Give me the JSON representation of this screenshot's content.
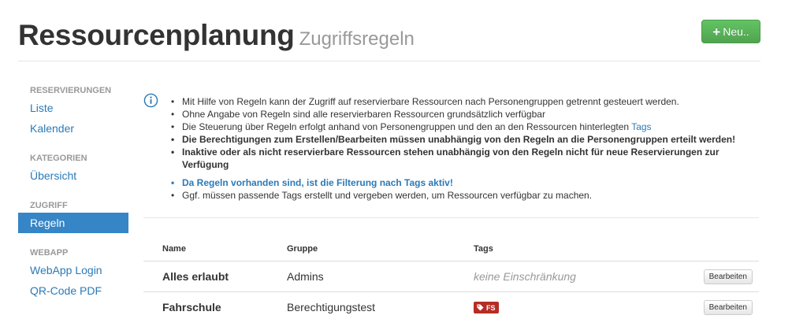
{
  "header": {
    "title": "Ressourcenplanung",
    "subtitle": "Zugriffsregeln",
    "new_label": "Neu.."
  },
  "sidebar": {
    "sections": [
      {
        "header": "RESERVIERUNGEN",
        "items": [
          {
            "label": "Liste",
            "active": false
          },
          {
            "label": "Kalender",
            "active": false
          }
        ]
      },
      {
        "header": "KATEGORIEN",
        "items": [
          {
            "label": "Übersicht",
            "active": false
          }
        ]
      },
      {
        "header": "ZUGRIFF",
        "items": [
          {
            "label": "Regeln",
            "active": true
          }
        ]
      },
      {
        "header": "WEBAPP",
        "items": [
          {
            "label": "WebApp Login",
            "active": false
          },
          {
            "label": "QR-Code PDF",
            "active": false
          }
        ]
      }
    ]
  },
  "info": {
    "icon": "info-circle-icon",
    "bullets": [
      "Mit Hilfe von Regeln kann der Zugriff auf reservierbare Ressourcen nach Personengruppen getrennt gesteuert werden.",
      "Ohne Angabe von Regeln sind alle reservierbaren Ressourcen grundsätzlich verfügbar",
      "Die Steuerung über Regeln erfolgt anhand von Personengruppen und den an den Ressourcen hinterlegten",
      "Die Berechtigungen zum Erstellen/Bearbeiten müssen unabhängig von den Regeln an die Personengruppen erteilt werden!",
      "Inaktive oder als nicht reservierbare Ressourcen stehen unabhängig von den Regeln nicht für neue Reservierungen zur Verfügung",
      "Da Regeln vorhanden sind, ist die Filterung nach Tags aktiv!",
      "Ggf. müssen passende Tags erstellt und vergeben werden, um Ressourcen verfügbar zu machen."
    ],
    "tags_link": "Tags"
  },
  "table": {
    "columns": [
      "Name",
      "Gruppe",
      "Tags"
    ],
    "rows": [
      {
        "name": "Alles erlaubt",
        "group": "Admins",
        "tags_text": "keine Einschränkung",
        "tag_badge": "",
        "action": "Bearbeiten"
      },
      {
        "name": "Fahrschule",
        "group": "Berechtigungstest",
        "tags_text": "",
        "tag_badge": "FS",
        "action": "Bearbeiten"
      }
    ]
  },
  "colors": {
    "accent": "#3685c6",
    "link": "#2a7ab8",
    "success": "#5bb75b",
    "tag": "#b52d24"
  }
}
